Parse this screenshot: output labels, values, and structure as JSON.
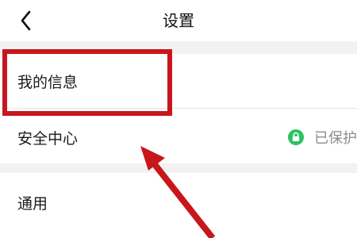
{
  "header": {
    "title": "设置",
    "back_icon": "chevron-left-icon"
  },
  "settings": {
    "my_info": {
      "label": "我的信息"
    },
    "security_center": {
      "label": "安全中心",
      "status_icon": "shield-lock-icon",
      "status_text": "已保护"
    },
    "general": {
      "label": "通用"
    }
  },
  "annotation": {
    "color": "#c8161d",
    "highlight_target": "我的信息",
    "arrow_icon": "arrow-up-left-icon"
  },
  "colors": {
    "status_green": "#2cc264",
    "background": "#f2f2f2"
  }
}
